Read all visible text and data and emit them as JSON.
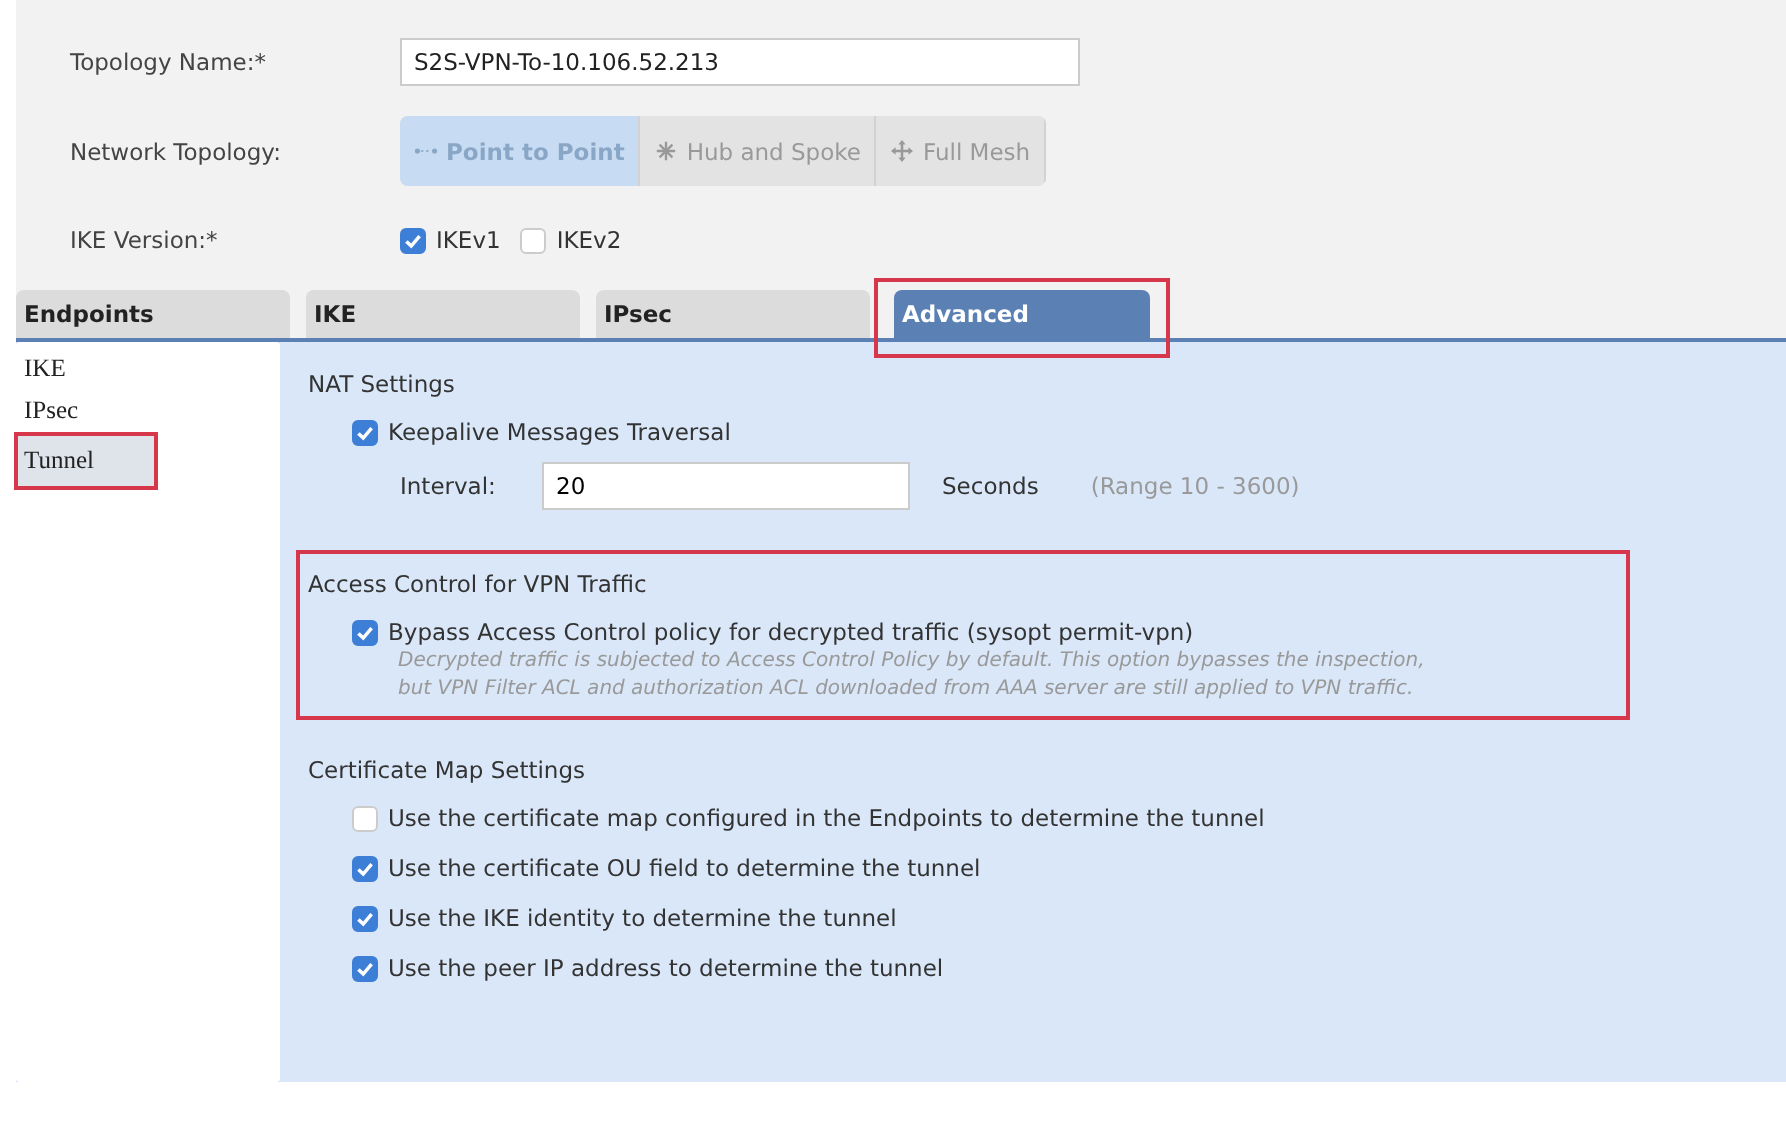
{
  "form": {
    "topology_name": {
      "label": "Topology Name:*",
      "value": "S2S-VPN-To-10.106.52.213"
    },
    "network_topology": {
      "label": "Network Topology:",
      "options": [
        {
          "label": "Point to Point",
          "kind": "line",
          "selected": true
        },
        {
          "label": "Hub and Spoke",
          "kind": "star",
          "selected": false
        },
        {
          "label": "Full Mesh",
          "kind": "cross",
          "selected": false
        }
      ]
    },
    "ike_version": {
      "label": "IKE Version:*",
      "options": [
        {
          "label": "IKEv1",
          "checked": true
        },
        {
          "label": "IKEv2",
          "checked": false
        }
      ]
    }
  },
  "tabs": [
    {
      "label": "Endpoints",
      "selected": false,
      "highlighted": false
    },
    {
      "label": "IKE",
      "selected": false,
      "highlighted": false
    },
    {
      "label": "IPsec",
      "selected": false,
      "highlighted": false
    },
    {
      "label": "Advanced",
      "selected": true,
      "highlighted": true
    }
  ],
  "sidebar": {
    "items": [
      {
        "label": "IKE",
        "selected": false,
        "highlighted": false
      },
      {
        "label": "IPsec",
        "selected": false,
        "highlighted": false
      },
      {
        "label": "Tunnel",
        "selected": true,
        "highlighted": true
      }
    ]
  },
  "nat": {
    "title": "NAT Settings",
    "keepalive": {
      "label": "Keepalive Messages Traversal",
      "checked": true
    },
    "interval": {
      "label": "Interval:",
      "value": "20",
      "unit": "Seconds",
      "range": "(Range 10 - 3600)"
    }
  },
  "access_control": {
    "title": "Access Control for VPN Traffic",
    "highlighted": true,
    "bypass": {
      "label": "Bypass Access Control policy for decrypted traffic (sysopt permit-vpn)",
      "checked": true,
      "description": [
        "Decrypted traffic is subjected to Access Control Policy by default. This option bypasses the inspection,",
        "but VPN Filter ACL and authorization ACL downloaded from AAA server are still applied to VPN traffic."
      ]
    }
  },
  "certificate_map": {
    "title": "Certificate Map Settings",
    "options": [
      {
        "label": "Use the certificate map configured in the Endpoints to determine the tunnel",
        "checked": false
      },
      {
        "label": "Use the certificate OU field to determine the tunnel",
        "checked": true
      },
      {
        "label": "Use the IKE identity to determine the tunnel",
        "checked": true
      },
      {
        "label": "Use the peer IP address to determine the tunnel",
        "checked": true
      }
    ]
  }
}
